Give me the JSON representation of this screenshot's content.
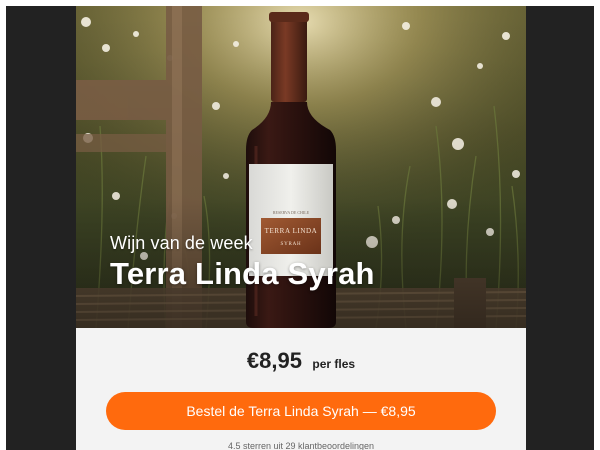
{
  "hero": {
    "kicker": "Wijn van de week",
    "title": "Terra Linda Syrah",
    "label_brand": "TERRA LINDA",
    "label_variety": "SYRAH",
    "label_top": "RESERVA DE CHILE"
  },
  "price": {
    "amount": "€8,95",
    "unit": "per fles"
  },
  "cta": {
    "label": "Bestel de Terra Linda Syrah — €8,95"
  },
  "rating": {
    "text": "4.5 sterren uit 29 klantbeoordelingen"
  },
  "colors": {
    "accent": "#ff6a0d",
    "background": "#f3f3f3",
    "frame": "#222222"
  }
}
